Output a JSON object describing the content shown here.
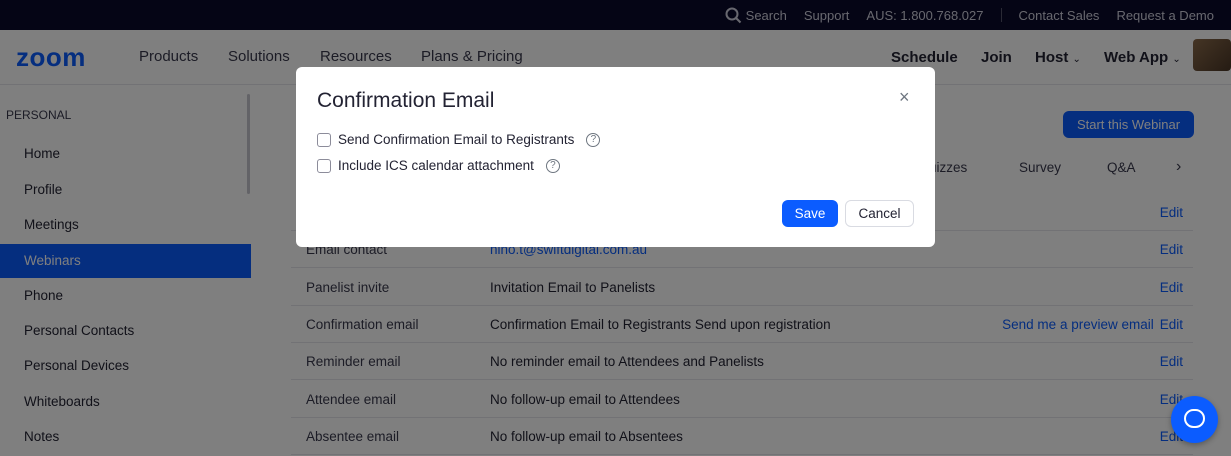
{
  "topbar": {
    "search": "Search",
    "support": "Support",
    "phone": "AUS: 1.800.768.027",
    "contact_sales": "Contact Sales",
    "request_demo": "Request a Demo"
  },
  "nav": {
    "logo": "zoom",
    "products": "Products",
    "solutions": "Solutions",
    "resources": "Resources",
    "plans": "Plans & Pricing",
    "schedule": "Schedule",
    "join": "Join",
    "host": "Host",
    "web_app": "Web App"
  },
  "sidebar": {
    "section": "PERSONAL",
    "items": [
      {
        "label": "Home"
      },
      {
        "label": "Profile"
      },
      {
        "label": "Meetings"
      },
      {
        "label": "Webinars"
      },
      {
        "label": "Phone"
      },
      {
        "label": "Personal Contacts"
      },
      {
        "label": "Personal Devices"
      },
      {
        "label": "Whiteboards"
      },
      {
        "label": "Notes"
      }
    ]
  },
  "main": {
    "start_button": "Start this Webinar",
    "tabs": [
      "uizzes",
      "Survey",
      "Q&A"
    ],
    "rows": [
      {
        "label": "",
        "value": "",
        "preview": "",
        "edit": "Edit"
      },
      {
        "label": "Email contact",
        "value": "nino.t@swiftdigital.com.au",
        "preview": "",
        "edit": "Edit"
      },
      {
        "label": "Panelist invite",
        "value": "Invitation Email to Panelists",
        "preview": "",
        "edit": "Edit"
      },
      {
        "label": "Confirmation email",
        "value": "Confirmation Email to Registrants Send upon registration",
        "preview": "Send me a preview email",
        "edit": "Edit"
      },
      {
        "label": "Reminder email",
        "value": "No reminder email to Attendees and Panelists",
        "preview": "",
        "edit": "Edit"
      },
      {
        "label": "Attendee email",
        "value": "No follow-up email to Attendees",
        "preview": "",
        "edit": "Edit"
      },
      {
        "label": "Absentee email",
        "value": "No follow-up email to Absentees",
        "preview": "",
        "edit": "Edit"
      }
    ]
  },
  "modal": {
    "title": "Confirmation Email",
    "close": "×",
    "option1": "Send Confirmation Email to Registrants",
    "option2": "Include ICS calendar attachment",
    "help": "?",
    "save": "Save",
    "cancel": "Cancel"
  },
  "colors": {
    "accent": "#0b5cff",
    "topbar_bg": "#0b0b2a"
  }
}
